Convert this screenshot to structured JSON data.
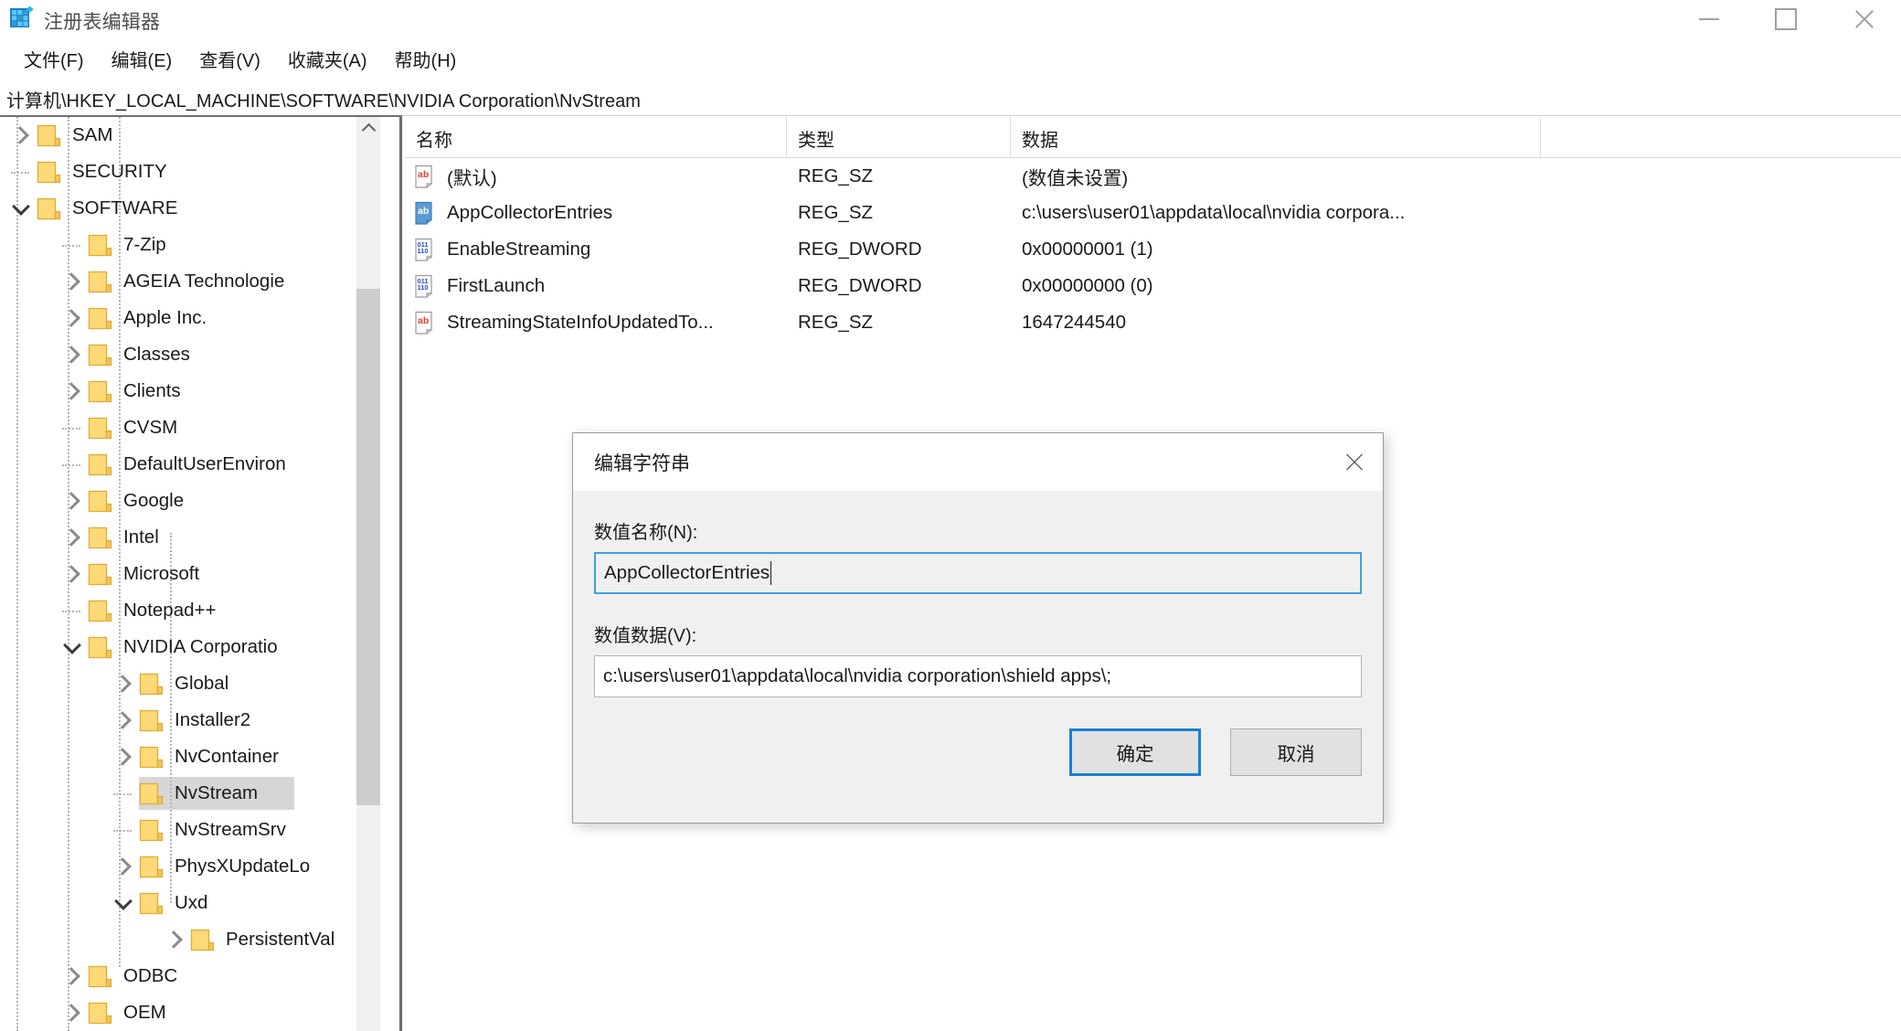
{
  "window": {
    "title": "注册表编辑器",
    "icon": "registry-editor-icon",
    "controls": {
      "minimize": "minimize",
      "maximize": "maximize",
      "close": "close"
    }
  },
  "menubar": {
    "items": [
      {
        "label": "文件(F)",
        "name": "menu-file"
      },
      {
        "label": "编辑(E)",
        "name": "menu-edit"
      },
      {
        "label": "查看(V)",
        "name": "menu-view"
      },
      {
        "label": "收藏夹(A)",
        "name": "menu-favorites"
      },
      {
        "label": "帮助(H)",
        "name": "menu-help"
      }
    ]
  },
  "address": {
    "path": "计算机\\HKEY_LOCAL_MACHINE\\SOFTWARE\\NVIDIA Corporation\\NvStream"
  },
  "tree": {
    "nodes": [
      {
        "label": "SAM",
        "indent": 1,
        "state": "collapsed",
        "selected": false
      },
      {
        "label": "SECURITY",
        "indent": 1,
        "state": "leaf",
        "selected": false
      },
      {
        "label": "SOFTWARE",
        "indent": 1,
        "state": "expanded",
        "selected": false
      },
      {
        "label": "7-Zip",
        "indent": 2,
        "state": "leaf",
        "selected": false
      },
      {
        "label": "AGEIA Technologie",
        "indent": 2,
        "state": "collapsed",
        "selected": false
      },
      {
        "label": "Apple Inc.",
        "indent": 2,
        "state": "collapsed",
        "selected": false
      },
      {
        "label": "Classes",
        "indent": 2,
        "state": "collapsed",
        "selected": false
      },
      {
        "label": "Clients",
        "indent": 2,
        "state": "collapsed",
        "selected": false
      },
      {
        "label": "CVSM",
        "indent": 2,
        "state": "leaf",
        "selected": false
      },
      {
        "label": "DefaultUserEnviron",
        "indent": 2,
        "state": "leaf",
        "selected": false
      },
      {
        "label": "Google",
        "indent": 2,
        "state": "collapsed",
        "selected": false
      },
      {
        "label": "Intel",
        "indent": 2,
        "state": "collapsed",
        "selected": false
      },
      {
        "label": "Microsoft",
        "indent": 2,
        "state": "collapsed",
        "selected": false
      },
      {
        "label": "Notepad++",
        "indent": 2,
        "state": "leaf",
        "selected": false
      },
      {
        "label": "NVIDIA Corporatio",
        "indent": 2,
        "state": "expanded",
        "selected": false
      },
      {
        "label": "Global",
        "indent": 3,
        "state": "collapsed",
        "selected": false
      },
      {
        "label": "Installer2",
        "indent": 3,
        "state": "collapsed",
        "selected": false
      },
      {
        "label": "NvContainer",
        "indent": 3,
        "state": "collapsed",
        "selected": false
      },
      {
        "label": "NvStream",
        "indent": 3,
        "state": "leaf",
        "selected": true
      },
      {
        "label": "NvStreamSrv",
        "indent": 3,
        "state": "leaf",
        "selected": false
      },
      {
        "label": "PhysXUpdateLo",
        "indent": 3,
        "state": "collapsed",
        "selected": false
      },
      {
        "label": "Uxd",
        "indent": 3,
        "state": "expanded",
        "selected": false
      },
      {
        "label": "PersistentVal",
        "indent": 4,
        "state": "collapsed",
        "selected": false
      },
      {
        "label": "ODBC",
        "indent": 2,
        "state": "collapsed",
        "selected": false
      },
      {
        "label": "OEM",
        "indent": 2,
        "state": "collapsed",
        "selected": false
      }
    ],
    "scrollbar": {
      "up_arrow": "scroll-up-icon"
    }
  },
  "list": {
    "columns": [
      {
        "label": "名称",
        "name": "column-header-name"
      },
      {
        "label": "类型",
        "name": "column-header-type"
      },
      {
        "label": "数据",
        "name": "column-header-data"
      }
    ],
    "rows": [
      {
        "name": "(默认)",
        "type": "REG_SZ",
        "data": "(数值未设置)",
        "icon": "string-value-icon",
        "selected": false
      },
      {
        "name": "AppCollectorEntries",
        "type": "REG_SZ",
        "data": "c:\\users\\user01\\appdata\\local\\nvidia corpora...",
        "icon": "string-value-icon",
        "selected": true
      },
      {
        "name": "EnableStreaming",
        "type": "REG_DWORD",
        "data": "0x00000001 (1)",
        "icon": "dword-value-icon",
        "selected": false
      },
      {
        "name": "FirstLaunch",
        "type": "REG_DWORD",
        "data": "0x00000000 (0)",
        "icon": "dword-value-icon",
        "selected": false
      },
      {
        "name": "StreamingStateInfoUpdatedTo...",
        "type": "REG_SZ",
        "data": "1647244540",
        "icon": "string-value-icon",
        "selected": false
      }
    ]
  },
  "dialog": {
    "title": "编辑字符串",
    "close_label": "close",
    "name_label": "数值名称(N):",
    "name_value": "AppCollectorEntries",
    "data_label": "数值数据(V):",
    "data_value": "c:\\users\\user01\\appdata\\local\\nvidia corporation\\shield apps\\;",
    "ok_label": "确定",
    "cancel_label": "取消"
  },
  "colors": {
    "accent": "#1a7fd4",
    "focus_border": "#3ea0e0",
    "folder": "#ffd977",
    "selection": "#d6d6d6",
    "string_icon": "#e8402a",
    "dword_icon": "#2b4fc4"
  }
}
